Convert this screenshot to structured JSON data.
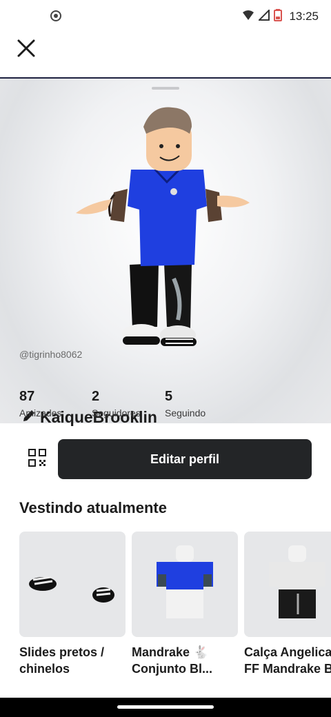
{
  "status_bar": {
    "time": "13:25",
    "left_icon": "record-icon",
    "icons": [
      "wifi-icon",
      "signal-icon",
      "battery-low-icon"
    ]
  },
  "header": {
    "close_icon": "close-icon"
  },
  "profile": {
    "display_name": "KaiqueBrooklin",
    "username": "@tigrinho8062",
    "edit_icon": "pencil-icon"
  },
  "stats": [
    {
      "value": "87",
      "label": "Amizades"
    },
    {
      "value": "2",
      "label": "Seguidores"
    },
    {
      "value": "5",
      "label": "Seguindo"
    }
  ],
  "actions": {
    "qr_icon": "qr-code-icon",
    "edit_profile_label": "Editar perfil"
  },
  "wearing": {
    "title": "Vestindo atualmente",
    "items": [
      {
        "name": "Slides pretos /\nchinelos"
      },
      {
        "name": "Mandrake 🐇\nConjunto Bl..."
      },
      {
        "name": "Calça Angelical\nFF Mandrake B"
      }
    ]
  },
  "colors": {
    "accent_dark": "#232527",
    "shirt_blue": "#1f3fe0",
    "skin": "#f5c9a0"
  }
}
